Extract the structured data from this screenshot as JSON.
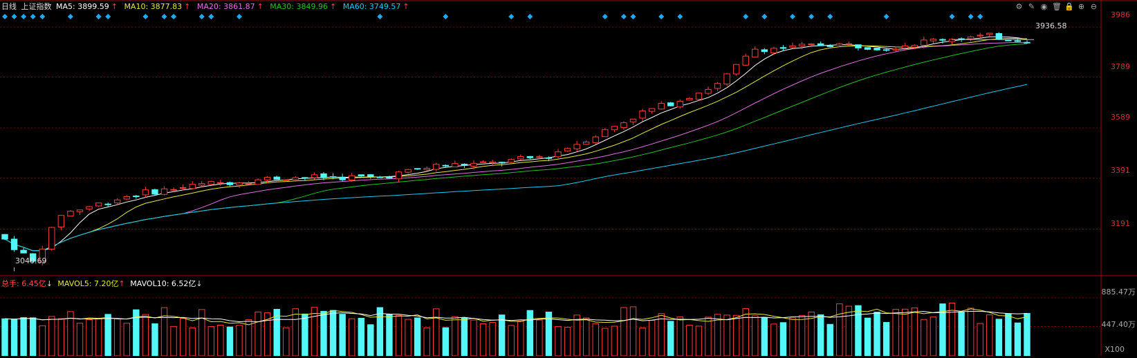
{
  "header": {
    "period": "日线",
    "name": "上证指数",
    "ma5": {
      "label": "MA5: 3899.59",
      "arrow": "↑",
      "color": "#ffffff"
    },
    "ma10": {
      "label": "MA10: 3877.83",
      "arrow": "↑",
      "color": "#e8e83a"
    },
    "ma20": {
      "label": "MA20: 3861.87",
      "arrow": "↑",
      "color": "#e070e0"
    },
    "ma30": {
      "label": "MA30: 3849.96",
      "arrow": "↑",
      "color": "#21c321"
    },
    "ma60": {
      "label": "MA60: 3749.57",
      "arrow": "↑",
      "color": "#20c8f0"
    }
  },
  "toolbar": [
    {
      "name": "settings-icon",
      "glyph": "⚙"
    },
    {
      "name": "draw-icon",
      "glyph": "✎"
    },
    {
      "name": "eye-icon",
      "glyph": "◉"
    },
    {
      "name": "trash-icon",
      "glyph": "🗑"
    },
    {
      "name": "lock-icon",
      "glyph": "🔒"
    },
    {
      "name": "zoom-in-icon",
      "glyph": "⊕"
    },
    {
      "name": "zoom-out-icon",
      "glyph": "⊖"
    }
  ],
  "volume_header": {
    "total": {
      "label": "总手: 6.45亿",
      "arrow": "↓",
      "color": "#ff4a4a"
    },
    "mavol5": {
      "label": "MAVOL5: 7.20亿",
      "arrow": "↑",
      "color": "#e8e83a"
    },
    "mavol10": {
      "label": "MAVOL10: 6.52亿",
      "arrow": "↓",
      "color": "#ffffff"
    }
  },
  "colors": {
    "up": "#ff3b3b",
    "down": "#54f7f7",
    "grid": "#7a0000",
    "axis": "#aa0000",
    "marker": "#20a8f0"
  },
  "chart_data": {
    "type": "candlestick",
    "price_ticks": [
      "3986",
      "3789",
      "3589",
      "3391",
      "3191"
    ],
    "price_tick_values": [
      3986,
      3789,
      3589,
      3391,
      3191
    ],
    "ylim": [
      3010,
      4038
    ],
    "high_annotation": "3936.58",
    "low_annotation": "3040.69",
    "high_value": 3936.58,
    "low_value": 3040.69,
    "volume_ticks": [
      "885.47万",
      "447.40万"
    ],
    "volume_tick_values": [
      885.47,
      447.4
    ],
    "volume_unit": "X100",
    "volume_ylim": [
      0,
      1000
    ]
  }
}
